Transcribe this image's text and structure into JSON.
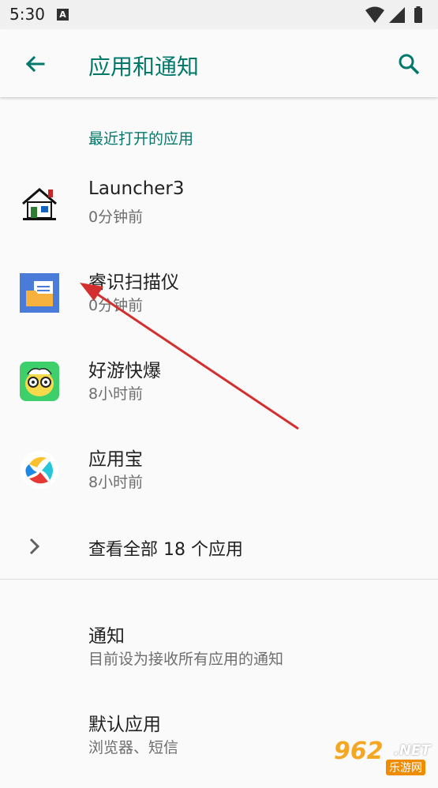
{
  "status": {
    "time": "5:30",
    "notif_letter": "A"
  },
  "header": {
    "title": "应用和通知"
  },
  "recent": {
    "header": "最近打开的应用",
    "apps": [
      {
        "name": "Launcher3",
        "time": "0分钟前",
        "icon": "house-icon"
      },
      {
        "name": "睿识扫描仪",
        "time": "0分钟前",
        "icon": "folder-scan-icon"
      },
      {
        "name": "好游快爆",
        "time": "8小时前",
        "icon": "game-mascot-icon"
      },
      {
        "name": "应用宝",
        "time": "8小时前",
        "icon": "app-store-icon"
      }
    ],
    "see_all": "查看全部 18 个应用"
  },
  "settings": [
    {
      "title": "通知",
      "summary": "目前设为接收所有应用的通知"
    },
    {
      "title": "默认应用",
      "summary": "浏览器、短信"
    }
  ],
  "watermark": {
    "number": "962",
    "suffix": ".NET",
    "sub": "乐游网"
  },
  "colors": {
    "accent": "#00796b",
    "annotation_arrow": "#d32f2f"
  }
}
